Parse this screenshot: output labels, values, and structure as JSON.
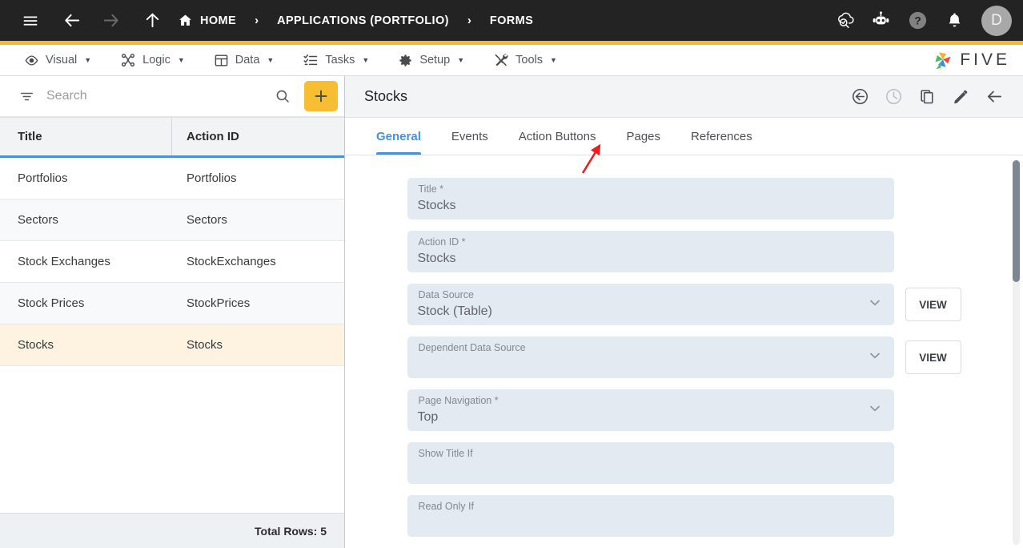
{
  "topbar": {
    "menu_icon": "hamburger-icon",
    "back_label": "back-arrow-icon",
    "forward_label": "forward-arrow-icon",
    "up_label": "up-arrow-icon",
    "breadcrumbs": [
      {
        "label": "HOME",
        "icon": "home-icon"
      },
      {
        "label": "APPLICATIONS (PORTFOLIO)",
        "icon": ""
      },
      {
        "label": "FORMS",
        "icon": ""
      }
    ],
    "separator": "›",
    "right_icons": [
      {
        "name": "cloud-search-icon"
      },
      {
        "name": "robot-assistant-icon"
      },
      {
        "name": "help-icon"
      },
      {
        "name": "notifications-bell-icon"
      }
    ],
    "avatar_initial": "D"
  },
  "menubar": {
    "items": [
      {
        "label": "Visual",
        "icon": "eye-icon",
        "caret": "▼"
      },
      {
        "label": "Logic",
        "icon": "logic-nodes-icon",
        "caret": "▼"
      },
      {
        "label": "Data",
        "icon": "table-grid-icon",
        "caret": "▼"
      },
      {
        "label": "Tasks",
        "icon": "checklist-icon",
        "caret": "▼"
      },
      {
        "label": "Setup",
        "icon": "gear-icon",
        "caret": "▼"
      },
      {
        "label": "Tools",
        "icon": "tools-wrench-icon",
        "caret": "▼"
      }
    ],
    "logo_text": "FIVE"
  },
  "sidebar": {
    "search": {
      "placeholder": "Search",
      "value": "",
      "filter_icon": "filter-icon",
      "search_icon": "search-icon"
    },
    "add_button": "+",
    "columns": [
      "Title",
      "Action ID"
    ],
    "rows": [
      {
        "title": "Portfolios",
        "action_id": "Portfolios"
      },
      {
        "title": "Sectors",
        "action_id": "Sectors"
      },
      {
        "title": "Stock Exchanges",
        "action_id": "StockExchanges"
      },
      {
        "title": "Stock Prices",
        "action_id": "StockPrices"
      },
      {
        "title": "Stocks",
        "action_id": "Stocks"
      }
    ],
    "selected_row_index": 4,
    "footer": "Total Rows: 5"
  },
  "main": {
    "title": "Stocks",
    "head_icons": [
      {
        "name": "revert-undo-icon",
        "enabled": true
      },
      {
        "name": "history-clock-icon",
        "enabled": false
      },
      {
        "name": "copy-duplicate-icon",
        "enabled": true
      },
      {
        "name": "edit-pencil-icon",
        "enabled": true
      },
      {
        "name": "back-arrow-icon",
        "enabled": true
      }
    ],
    "tabs": [
      {
        "label": "General",
        "active": true
      },
      {
        "label": "Events",
        "active": false
      },
      {
        "label": "Action Buttons",
        "active": false
      },
      {
        "label": "Pages",
        "active": false
      },
      {
        "label": "References",
        "active": false
      }
    ],
    "fields": [
      {
        "label": "Title *",
        "value": "Stocks",
        "type": "text",
        "view_button": ""
      },
      {
        "label": "Action ID *",
        "value": "Stocks",
        "type": "text",
        "view_button": ""
      },
      {
        "label": "Data Source",
        "value": "Stock (Table)",
        "type": "select",
        "view_button": "VIEW"
      },
      {
        "label": "Dependent Data Source",
        "value": "",
        "type": "select",
        "view_button": "VIEW"
      },
      {
        "label": "Page Navigation *",
        "value": "Top",
        "type": "select",
        "view_button": ""
      },
      {
        "label": "Show Title If",
        "value": "",
        "type": "text",
        "view_button": ""
      },
      {
        "label": "Read Only If",
        "value": "",
        "type": "text",
        "view_button": ""
      }
    ]
  },
  "annotation": {
    "type": "red-arrow",
    "points_to": "Pages"
  },
  "colors": {
    "topbar_bg": "#232323",
    "accent_yellow": "#f5b934",
    "add_button": "#f7bd33",
    "tab_active_blue": "#4a90d9",
    "selected_row": "#fdf3e0",
    "field_bg": "#e4eaf2",
    "annotation_red": "#ee1c1c"
  }
}
